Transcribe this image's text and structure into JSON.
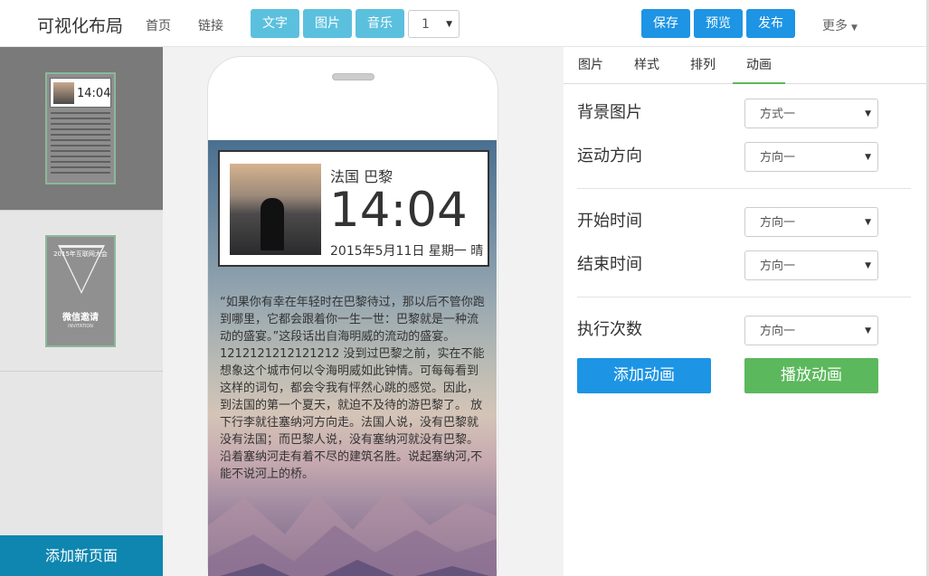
{
  "app": {
    "title": "可视化布局"
  },
  "nav": {
    "home": "首页",
    "links": "链接"
  },
  "toolbar": {
    "text_button": "文字",
    "image_button": "图片",
    "music_button": "音乐",
    "page_select_value": "1",
    "save_button": "保存",
    "preview_button": "预览",
    "publish_button": "发布",
    "more_label": "更多"
  },
  "colors": {
    "accent_cyan": "#5bc0de",
    "accent_blue": "#1d94e4",
    "success_green": "#5cb85c",
    "add_page_bg": "#0e86b0"
  },
  "sidebar": {
    "pages": [
      {
        "thumb_time": "14:04"
      },
      {
        "thumb_title": "2015年互联网大会",
        "thumb_logo": "微信邀请",
        "thumb_sub": "INVITATION"
      }
    ],
    "add_page_label": "添加新页面"
  },
  "phone": {
    "card": {
      "city": "法国 巴黎",
      "time": "14:04",
      "date": "2015年5月11日 星期一 晴"
    },
    "article": "“如果你有幸在年轻时在巴黎待过，那以后不管你跑到哪里，它都会跟着你一生一世：巴黎就是一种流动的盛宴。”这段话出自海明威的流动的盛宴。 1212121212121212 没到过巴黎之前，实在不能想象这个城市何以令海明威如此钟情。可每每看到这样的词句，都会令我有怦然心跳的感觉。因此，到法国的第一个夏天，就迫不及待的游巴黎了。 放下行李就往塞纳河方向走。法国人说，没有巴黎就没有法国；而巴黎人说，没有塞纳河就没有巴黎。沿着塞纳河走有着不尽的建筑名胜。说起塞纳河,不能不说河上的桥。"
  },
  "panel": {
    "tabs": [
      "图片",
      "样式",
      "排列",
      "动画"
    ],
    "active_tab": "动画",
    "fields": {
      "bg_image": {
        "label": "背景图片",
        "value": "方式一"
      },
      "direction": {
        "label": "运动方向",
        "value": "方向一"
      },
      "start_time": {
        "label": "开始时间",
        "value": "方向一"
      },
      "end_time": {
        "label": "结束时间",
        "value": "方向一"
      },
      "repeat": {
        "label": "执行次数",
        "value": "方向一"
      }
    },
    "add_animation": "添加动画",
    "play_animation": "播放动画"
  }
}
